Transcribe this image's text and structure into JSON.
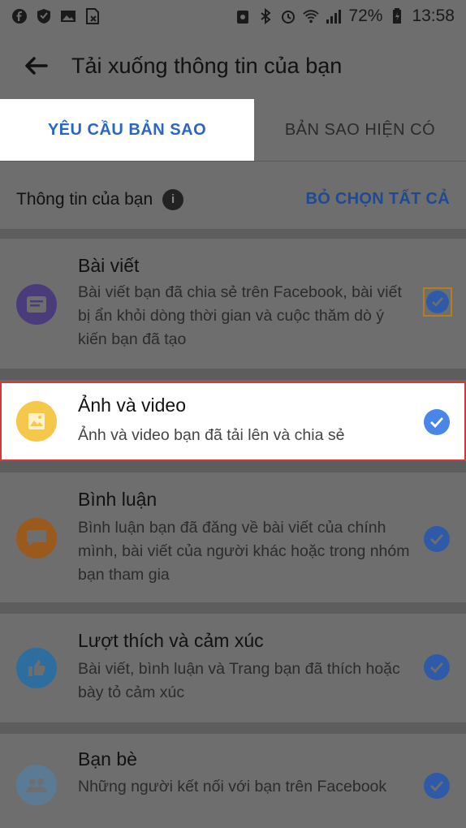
{
  "status_bar": {
    "battery_percent": "72%",
    "time": "13:58",
    "left_icons": [
      "facebook-icon",
      "shield-icon",
      "gallery-icon",
      "file-x-icon"
    ],
    "right_icons": [
      "notification-icon",
      "bluetooth-icon",
      "alarm-icon",
      "wifi-icon",
      "signal-icon",
      "battery-icon"
    ]
  },
  "header": {
    "title": "Tải xuống thông tin của bạn"
  },
  "tabs": [
    {
      "label": "YÊU CẦU BẢN SAO",
      "active": true
    },
    {
      "label": "BẢN SAO HIỆN CÓ",
      "active": false
    }
  ],
  "section": {
    "label": "Thông tin của bạn",
    "deselect_label": "BỎ CHỌN TẤT CẢ"
  },
  "items": [
    {
      "title": "Bài viết",
      "desc": "Bài viết bạn đã chia sẻ trên Facebook, bài viết bị ẩn khỏi dòng thời gian và cuộc thăm dò ý kiến bạn đã tạo",
      "icon": "posts-icon",
      "color": "#4a3b7a",
      "checked": true
    },
    {
      "title": "Ảnh và video",
      "desc": "Ảnh và video bạn đã tải lên và chia sẻ",
      "icon": "photo-icon",
      "color": "#f5c84b",
      "checked": true
    },
    {
      "title": "Bình luận",
      "desc": "Bình luận bạn đã đăng về bài viết của chính mình, bài viết của người khác hoặc trong nhóm bạn tham gia",
      "icon": "comment-icon",
      "color": "#9a5a1e",
      "checked": true
    },
    {
      "title": "Lượt thích và cảm xúc",
      "desc": "Bài viết, bình luận và Trang bạn đã thích hoặc bày tỏ cảm xúc",
      "icon": "like-icon",
      "color": "#2e6e9e",
      "checked": true
    },
    {
      "title": "Bạn bè",
      "desc": "Những người kết nối với bạn trên Facebook",
      "icon": "friends-icon",
      "color": "#5b7b95",
      "checked": true
    }
  ],
  "colors": {
    "accent": "#2b66c6",
    "highlight_border": "#d23a3a"
  }
}
